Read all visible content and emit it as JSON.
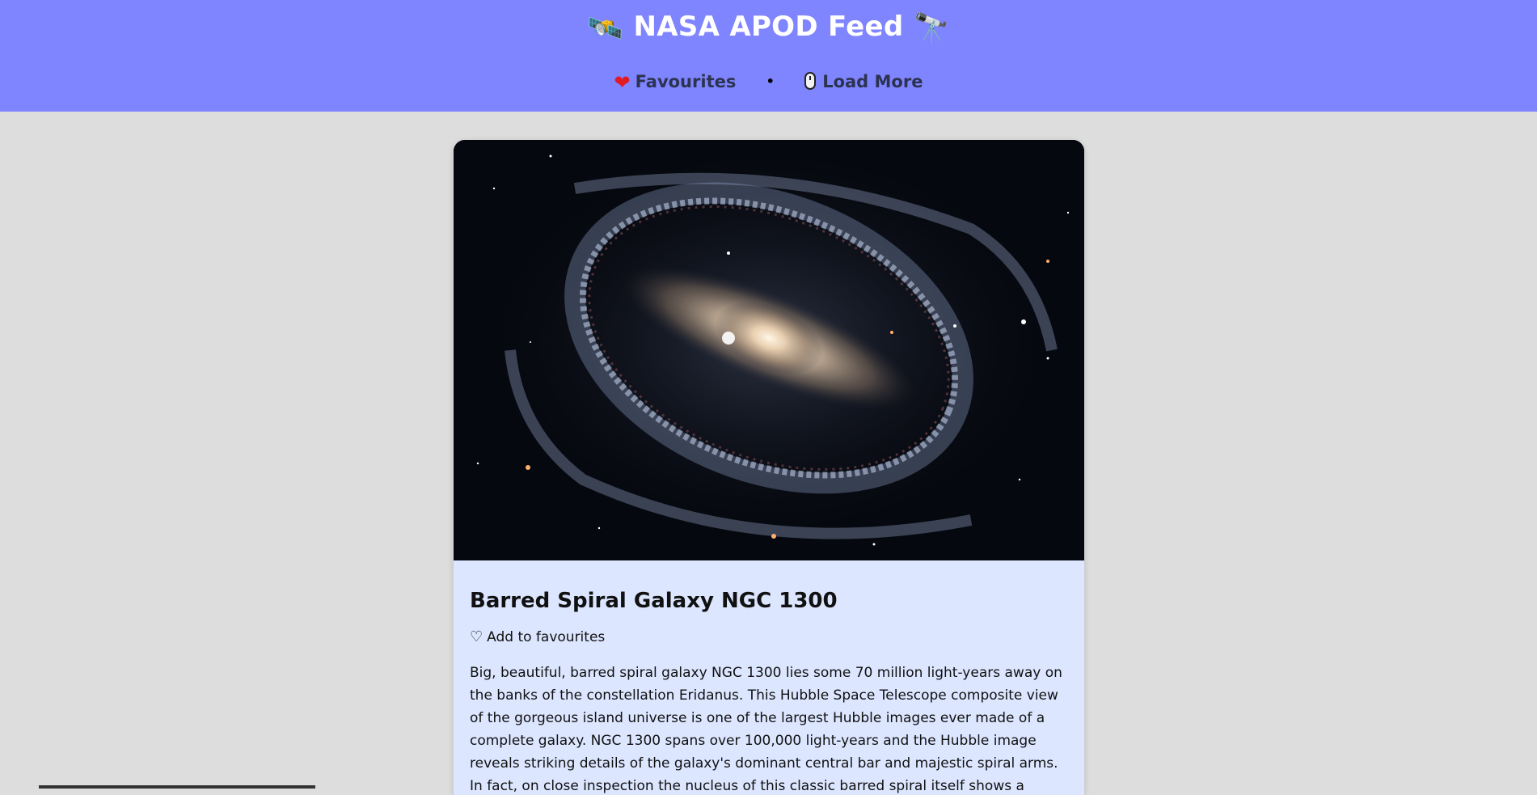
{
  "header": {
    "title": "NASA APOD Feed",
    "title_left_icon": "satellite-icon",
    "title_right_icon": "telescope-icon",
    "nav": {
      "favourites_label": "Favourites",
      "favourites_icon": "heart-icon",
      "separator": "•",
      "load_more_label": "Load More",
      "load_more_icon": "mouse-icon"
    }
  },
  "colors": {
    "header_bg": "#7f84ff",
    "page_bg": "#dddddd",
    "card_bg": "#dce6ff"
  },
  "card": {
    "image_alt": "Barred Spiral Galaxy NGC 1300",
    "title": "Barred Spiral Galaxy NGC 1300",
    "favourite_label": "Add to favourites",
    "favourite_icon": "heart-outline-icon",
    "explanation": "Big, beautiful, barred spiral galaxy NGC 1300 lies some 70 million light-years away on the banks of the constellation Eridanus. This Hubble Space Telescope composite view of the gorgeous island universe is one of the largest Hubble images ever made of a complete galaxy. NGC 1300 spans over 100,000 light-years and the Hubble image reveals striking details of the galaxy's dominant central bar and majestic spiral arms. In fact, on close inspection the nucleus of this classic barred spiral itself shows a remarkable region of spiral"
  }
}
